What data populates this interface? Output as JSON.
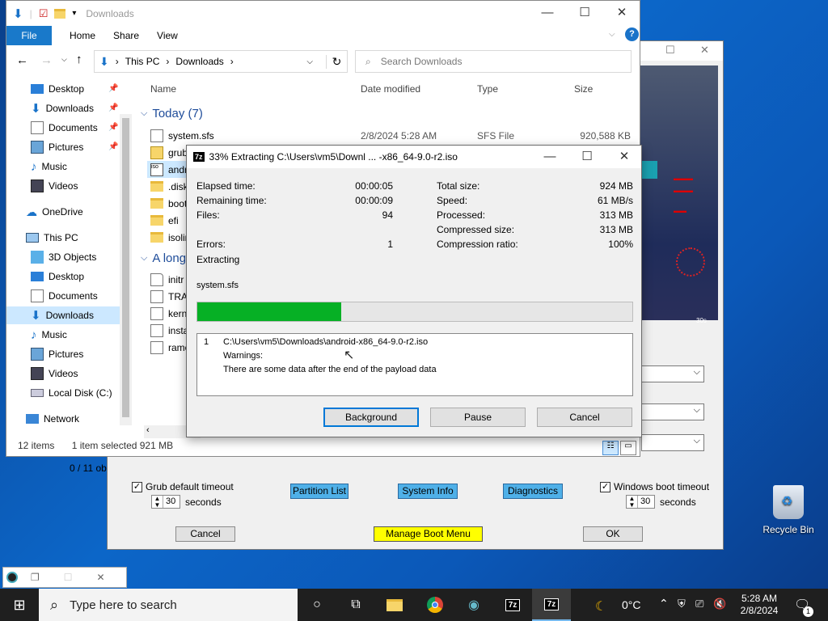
{
  "colors": {
    "accent": "#1979ca",
    "progress": "#06b025",
    "selection": "#cce8ff",
    "taskbar": "#1f1f1f"
  },
  "explorer": {
    "title": "Downloads",
    "ribbon": {
      "file": "File",
      "home": "Home",
      "share": "Share",
      "view": "View"
    },
    "address": {
      "this_pc": "This PC",
      "folder": "Downloads"
    },
    "search_placeholder": "Search Downloads",
    "nav": {
      "desktop": "Desktop",
      "downloads": "Downloads",
      "documents": "Documents",
      "pictures": "Pictures",
      "music": "Music",
      "videos": "Videos",
      "onedrive": "OneDrive",
      "this_pc": "This PC",
      "objects3d": "3D Objects",
      "pc_desktop": "Desktop",
      "pc_documents": "Documents",
      "pc_downloads": "Downloads",
      "pc_music": "Music",
      "pc_pictures": "Pictures",
      "pc_videos": "Videos",
      "local_disk": "Local Disk (C:)",
      "network": "Network"
    },
    "columns": {
      "name": "Name",
      "date": "Date modified",
      "type": "Type",
      "size": "Size"
    },
    "groups": {
      "today": "Today (7)",
      "long_ago": "A long"
    },
    "files": [
      {
        "name": "system.sfs",
        "date": "2/8/2024 5:28 AM",
        "type": "SFS File",
        "size": "920,588 KB"
      },
      {
        "name": "grub",
        "date": "",
        "type": "",
        "size": ""
      },
      {
        "name": "andr",
        "date": "",
        "type": "",
        "size": ""
      },
      {
        "name": ".disk",
        "date": "",
        "type": "",
        "size": ""
      },
      {
        "name": "boot",
        "date": "",
        "type": "",
        "size": ""
      },
      {
        "name": "efi",
        "date": "",
        "type": "",
        "size": ""
      },
      {
        "name": "isolin",
        "date": "",
        "type": "",
        "size": ""
      }
    ],
    "old_files": [
      "initr",
      "TRAN",
      "kern",
      "insta",
      "ramo"
    ],
    "status": {
      "count": "12 items",
      "selected": "1 item selected  921 MB"
    }
  },
  "extract": {
    "title": "33% Extracting C:\\Users\\vm5\\Downl ... -x86_64-9.0-r2.iso",
    "left": [
      {
        "label": "Elapsed time:",
        "value": "00:00:05"
      },
      {
        "label": "Remaining time:",
        "value": "00:00:09"
      },
      {
        "label": "Files:",
        "value": "94"
      }
    ],
    "errors_label": "Errors:",
    "errors_value": "1",
    "right": [
      {
        "label": "Total size:",
        "value": "924 MB"
      },
      {
        "label": "Speed:",
        "value": "61 MB/s"
      },
      {
        "label": "Processed:",
        "value": "313 MB"
      },
      {
        "label": "Compressed size:",
        "value": "313 MB"
      },
      {
        "label": "Compression ratio:",
        "value": "100%"
      }
    ],
    "action": "Extracting",
    "current_file": "system.sfs",
    "progress": 0.33,
    "message": {
      "index": "1",
      "path": "C:\\Users\\vm5\\Downloads\\android-x86_64-9.0-r2.iso",
      "warn": "Warnings:",
      "text": "There are some data after the end of the payload data"
    },
    "buttons": {
      "background": "Background",
      "pause": "Pause",
      "cancel": "Cancel"
    }
  },
  "boot": {
    "counter": "0 / 11 ob",
    "preview_time": "30s",
    "grub_timeout_label": "Grub default timeout",
    "win_timeout_label": "Windows boot timeout",
    "grub_seconds": "30",
    "win_seconds": "30",
    "seconds": "seconds",
    "partition": "Partition List",
    "sysinfo": "System Info",
    "diagnostics": "Diagnostics",
    "cancel": "Cancel",
    "manage": "Manage Boot Menu",
    "ok": "OK"
  },
  "desktop": {
    "recycle_bin": "Recycle Bin"
  },
  "taskbar": {
    "search_placeholder": "Type here to search",
    "temp": "0°C",
    "time": "5:28 AM",
    "date": "2/8/2024",
    "notif_count": "1"
  }
}
